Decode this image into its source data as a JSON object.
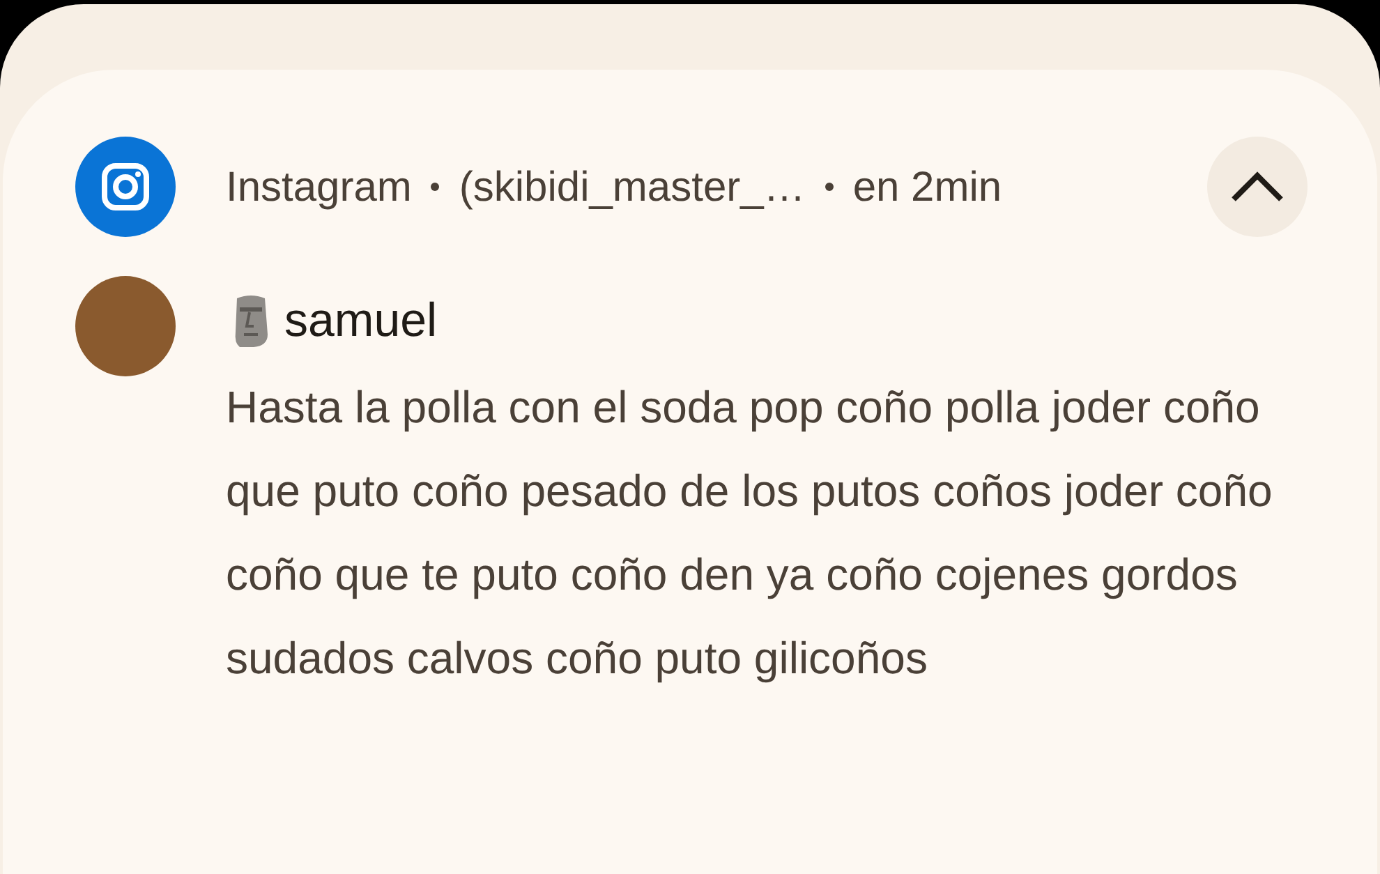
{
  "notification": {
    "app_name": "Instagram",
    "account": "(skibidi_master_…",
    "time": "en 2min",
    "expanded": true,
    "sender": "samuel",
    "message": "Hasta la polla con el soda pop coño polla joder coño que puto coño pesado de los putos coños joder coño coño que te puto coño den ya coño cojenes gordos sudados calvos coño puto gilicoños"
  }
}
